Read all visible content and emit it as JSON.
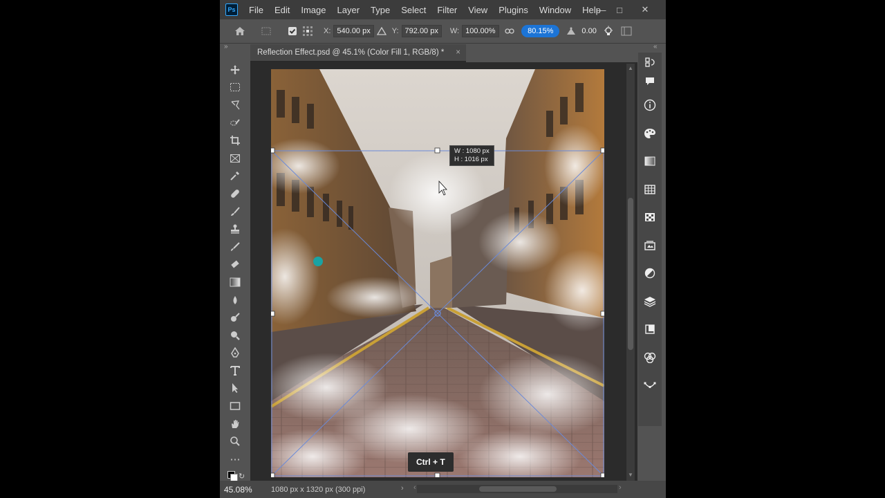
{
  "menu": {
    "logo": "Ps",
    "items": [
      "File",
      "Edit",
      "Image",
      "Layer",
      "Type",
      "Select",
      "Filter",
      "View",
      "Plugins",
      "Window",
      "Help"
    ]
  },
  "options": {
    "x_label": "X:",
    "x_value": "540.00 px",
    "y_label": "Y:",
    "y_value": "792.00 px",
    "w_label": "W:",
    "w_value": "100.00%",
    "h_value": "80.15%",
    "angle_value": "0.00"
  },
  "document": {
    "tab_title": "Reflection Effect.psd @ 45.1% (Color Fill 1, RGB/8) *",
    "tab_close": "×"
  },
  "transform": {
    "width_readout": "W :  1080 px",
    "height_readout": "H :  1016 px",
    "shortcut_badge": "Ctrl + T"
  },
  "status": {
    "zoom": "45.08%",
    "doc_info": "1080 px x 1320 px (300 ppi)"
  },
  "icons": {
    "tools": [
      "move-icon",
      "marquee-icon",
      "lasso-icon",
      "quick-select-icon",
      "crop-icon",
      "frame-icon",
      "eyedropper-icon",
      "healing-icon",
      "brush-icon",
      "stamp-icon",
      "history-brush-icon",
      "eraser-icon",
      "gradient-icon",
      "blur-icon",
      "dodge-icon",
      "sponge-icon",
      "pen-icon",
      "type-icon",
      "path-select-icon",
      "rectangle-icon",
      "hand-icon",
      "zoom-icon",
      "more-tools-icon"
    ],
    "panels": [
      "history-icon",
      "comments-icon",
      "info-icon",
      "color-icon",
      "gradients-icon",
      "swatches-icon",
      "patterns-icon",
      "libraries-icon",
      "adjustments-icon",
      "layers-icon",
      "channels-icon",
      "paths-icon",
      "navigator-icon",
      "properties-icon"
    ]
  },
  "colors": {
    "accent": "#1c74d6",
    "transform_guide": "#6a8ad8"
  }
}
